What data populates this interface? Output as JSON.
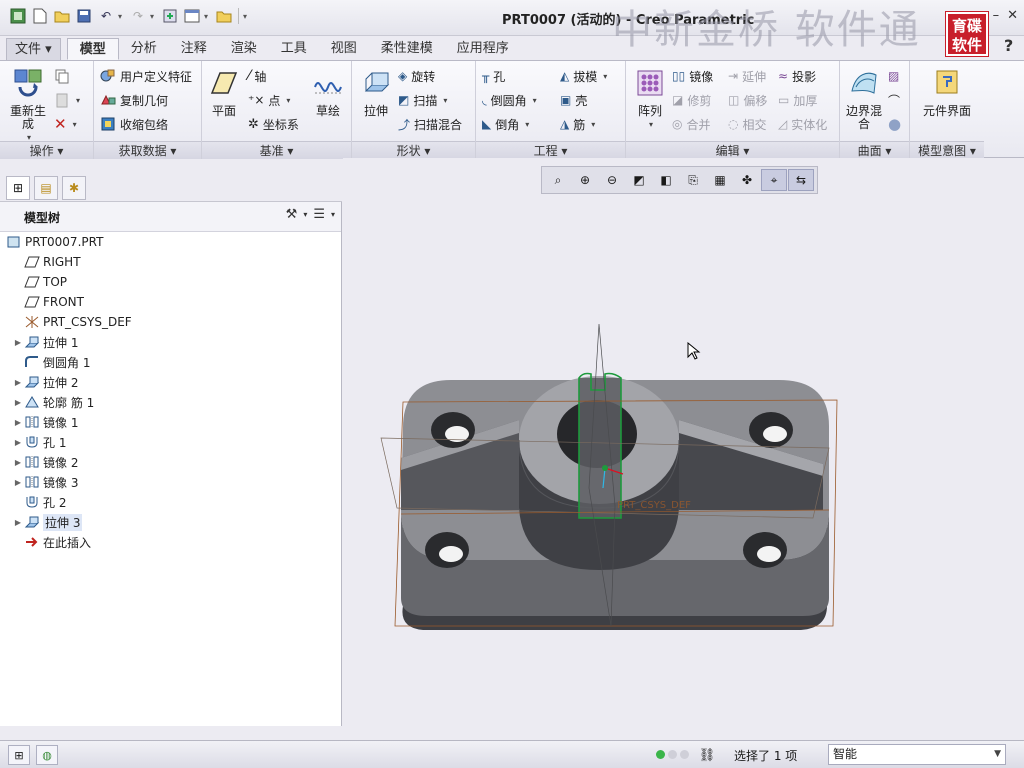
{
  "window": {
    "title": "PRT0007 (活动的) - Creo Parametric",
    "watermark": "中新金桥  软件通",
    "logo_text": "育碟软件",
    "controls": [
      "–",
      "✕",
      "?"
    ]
  },
  "tabs": {
    "file": "文件",
    "items": [
      "模型",
      "分析",
      "注释",
      "渲染",
      "工具",
      "视图",
      "柔性建模",
      "应用程序"
    ],
    "active": "模型"
  },
  "ribbon": {
    "groups": {
      "operations": "操作",
      "get_data": "获取数据",
      "datum": "基准",
      "shapes": "形状",
      "engineering": "工程",
      "editing": "编辑",
      "surfaces": "曲面",
      "model_intent": "模型意图"
    },
    "regenerate": "重新生成",
    "user_defined_feature": "用户定义特征",
    "copy_geometry": "复制几何",
    "shrinkwrap": "收缩包络",
    "plane": "平面",
    "axis": "轴",
    "point": "点",
    "csys": "坐标系",
    "sketch": "草绘",
    "extrude": "拉伸",
    "revolve": "旋转",
    "sweep": "扫描",
    "swept_blend": "扫描混合",
    "hole": "孔",
    "round": "倒圆角",
    "chamfer": "倒角",
    "draft": "拔模",
    "shell": "壳",
    "rib": "筋",
    "pattern": "阵列",
    "mirror": "镜像",
    "trim": "修剪",
    "merge": "合并",
    "extend": "延伸",
    "offset": "偏移",
    "intersect": "相交",
    "project": "投影",
    "thicken": "加厚",
    "solidify": "实体化",
    "boundary_blend": "边界混合",
    "component_interface": "元件界面"
  },
  "left_panel": {
    "tree_title": "模型树",
    "items": [
      {
        "label": "PRT0007.PRT",
        "icon": "part-icon",
        "expand": false,
        "root": true
      },
      {
        "label": "RIGHT",
        "icon": "datum-plane-icon",
        "expand": false
      },
      {
        "label": "TOP",
        "icon": "datum-plane-icon",
        "expand": false
      },
      {
        "label": "FRONT",
        "icon": "datum-plane-icon",
        "expand": false
      },
      {
        "label": "PRT_CSYS_DEF",
        "icon": "csys-icon",
        "expand": false
      },
      {
        "label": "拉伸 1",
        "icon": "extrude-icon",
        "expand": true
      },
      {
        "label": "倒圆角 1",
        "icon": "round-icon",
        "expand": false
      },
      {
        "label": "拉伸 2",
        "icon": "extrude-icon",
        "expand": true
      },
      {
        "label": "轮廓 筋 1",
        "icon": "rib-icon",
        "expand": true
      },
      {
        "label": "镜像 1",
        "icon": "mirror-icon",
        "expand": true
      },
      {
        "label": "孔 1",
        "icon": "hole-icon",
        "expand": true
      },
      {
        "label": "镜像 2",
        "icon": "mirror-icon",
        "expand": true
      },
      {
        "label": "镜像 3",
        "icon": "mirror-icon",
        "expand": true
      },
      {
        "label": "孔 2",
        "icon": "hole-icon",
        "expand": false
      },
      {
        "label": "拉伸 3",
        "icon": "extrude-icon",
        "expand": true,
        "selected": true
      },
      {
        "label": "在此插入",
        "icon": "insert-arrow-icon",
        "expand": false
      }
    ]
  },
  "graphics": {
    "csys_label": "PRT_CSYS_DEF"
  },
  "status": {
    "selection": "选择了 1 项",
    "filter_value": "智能"
  },
  "colors": {
    "background": "#ecebf2",
    "part_grey": "#8d8e93",
    "edge_green": "#1d9a3c",
    "datum_brown": "#9a5a2b"
  }
}
